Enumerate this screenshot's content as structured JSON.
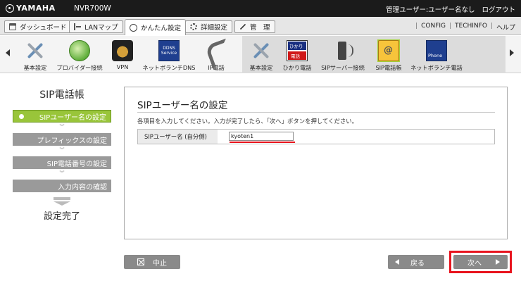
{
  "header": {
    "brand": "YAMAHA",
    "model": "NVR700W",
    "user_status": "管理ユーザー:ユーザー名なし",
    "logout": "ログアウト"
  },
  "menu": {
    "tabs": [
      {
        "label": "ダッシュボード",
        "icon": "dashboard-icon"
      },
      {
        "label": "LANマップ",
        "icon": "lan-map-icon"
      },
      {
        "label": "かんたん設定",
        "icon": "wizard-icon",
        "active": true
      },
      {
        "label": "詳細設定",
        "icon": "gear-icon"
      },
      {
        "label": "管　理",
        "icon": "tools-icon"
      }
    ],
    "links": {
      "config": "CONFIG",
      "sep": "|",
      "techinfo": "TECHINFO",
      "help": "ヘルプ"
    }
  },
  "iconbar": {
    "items": [
      {
        "label": "基本設定",
        "icon": "tools-icon"
      },
      {
        "label": "プロバイダー接続",
        "icon": "globe-icon"
      },
      {
        "label": "VPN",
        "icon": "vpn-icon"
      },
      {
        "label": "ネットボランチDNS",
        "icon": "ddns-icon",
        "badge": "DDNS Service"
      },
      {
        "label": "IP電話",
        "icon": "phone-icon"
      },
      {
        "label": "基本設定",
        "icon": "tools-icon"
      },
      {
        "label": "ひかり電話",
        "icon": "hikari-phone-icon",
        "badge_top": "ひかり",
        "badge_bottom": "電話"
      },
      {
        "label": "SIPサーバー接続",
        "icon": "sip-server-icon"
      },
      {
        "label": "SIP電話帳",
        "icon": "address-book-icon",
        "selected": true
      },
      {
        "label": "ネットボランチ電話",
        "icon": "phone-service-icon"
      }
    ]
  },
  "steps": {
    "title": "SIP電話帳",
    "items": [
      {
        "label": "SIPユーザー名の設定",
        "active": true
      },
      {
        "label": "プレフィックスの設定"
      },
      {
        "label": "SIP電話番号の設定"
      },
      {
        "label": "入力内容の確認"
      }
    ],
    "chevron": "︾",
    "done": "設定完了"
  },
  "panel": {
    "title": "SIPユーザー名の設定",
    "description": "各項目を入力してください。入力が完了したら、「次へ」ボタンを押してください。",
    "field_label": "SIPユーザー名 (自分側)",
    "field_value": "kyoten1"
  },
  "buttons": {
    "cancel": "中止",
    "back": "戻る",
    "next": "次へ"
  },
  "colors": {
    "active_step": "#99c53a",
    "highlight": "#e8141e",
    "button_gray": "#8a8a8a"
  }
}
